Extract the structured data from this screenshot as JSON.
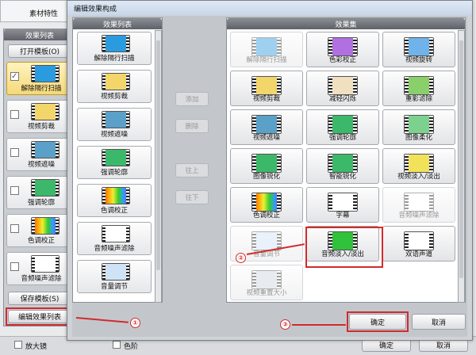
{
  "bg_app": {
    "tab_label": "素材特性",
    "panel_title": "效果列表",
    "open_template": "打开模板(O)",
    "save_template": "保存模板(S)",
    "edit_list": "编辑效果列表",
    "items": [
      "解除隔行扫描",
      "视频剪裁",
      "视频遮噪",
      "强调轮廓",
      "色调校正",
      "音频噪声滤除"
    ],
    "zoom_label": "放大镜",
    "levels_label": "色阶",
    "ok": "确定",
    "cancel": "取消"
  },
  "dialog": {
    "title": "编辑效果构成",
    "list_title": "效果列表",
    "set_title": "效果集",
    "list": [
      "解除隔行扫描",
      "视频剪裁",
      "视频遮噪",
      "强调轮廓",
      "色调校正",
      "音频噪声滤除",
      "音量调节"
    ],
    "buttons": {
      "add": "添加",
      "delete": "删除",
      "up": "往上",
      "down": "往下"
    },
    "effects": [
      [
        "解除隔行扫描",
        "色彩校正",
        "视频旋转"
      ],
      [
        "视频剪裁",
        "减轻闪烁",
        "重影滤除"
      ],
      [
        "视频遮噪",
        "强调轮廓",
        "图像柔化"
      ],
      [
        "图像锐化",
        "智能锐化",
        "视频淡入/淡出"
      ],
      [
        "色调校正",
        "字幕",
        "音频噪声滤除"
      ],
      [
        "音量调节",
        "音频淡入/淡出",
        "双语声道"
      ],
      [
        "视频重置大小"
      ]
    ],
    "ok": "确定",
    "cancel": "取消"
  },
  "callouts": [
    "①",
    "②",
    "③"
  ],
  "colors": {
    "highlight": "#d12b2b",
    "selected": "#f5d879"
  }
}
